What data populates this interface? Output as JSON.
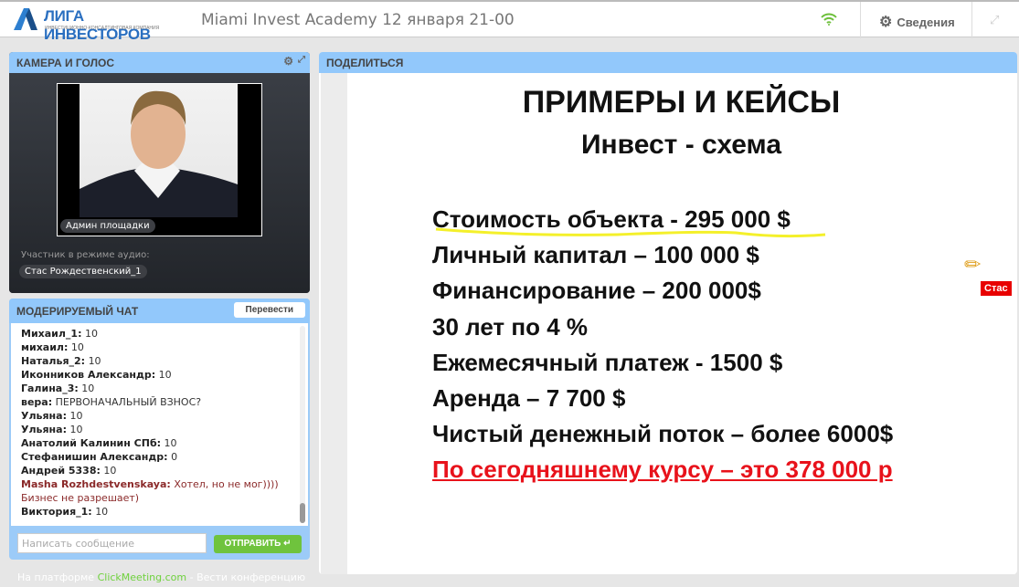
{
  "header": {
    "logo_name": "ЛИГА ИНВЕСТОРОВ",
    "logo_tagline": "ИНВЕСТИЦИОННО-КОНСАЛТИНГОВАЯ КОМПАНИЯ",
    "title": "Miami Invest Academy 12 января 21-00",
    "info_label": "Сведения"
  },
  "camera": {
    "title": "КАМЕРА И ГОЛОС",
    "presenter": "Админ площадки",
    "audio_label": "Участник в режиме аудио:",
    "audio_participant": "Стас Рождественский_1"
  },
  "chat": {
    "title": "МОДЕРИРУЕМЫЙ ЧАТ",
    "translate_label": "Перевести",
    "messages": [
      {
        "name": "Михаил_1:",
        "text": "10"
      },
      {
        "name": "михаил:",
        "text": "10"
      },
      {
        "name": "Наталья_2:",
        "text": "10"
      },
      {
        "name": "Иконников Александр:",
        "text": "10"
      },
      {
        "name": "Галина_3:",
        "text": "10"
      },
      {
        "name": "вера:",
        "text": "ПЕРВОНАЧАЛЬНЫЙ ВЗНОС?"
      },
      {
        "name": "Ульяна:",
        "text": "10"
      },
      {
        "name": "Ульяна:",
        "text": "10"
      },
      {
        "name": "Анатолий Калинин СПб:",
        "text": "10"
      },
      {
        "name": "Стефанишин Александр:",
        "text": "0"
      },
      {
        "name": "Андрей 5338:",
        "text": "10"
      },
      {
        "name": "Masha Rozhdestvenskaya:",
        "text": "Хотел, но не мог))))",
        "text2": "Бизнес не разрешает)"
      },
      {
        "name": "Виктория_1:",
        "text": "10"
      }
    ],
    "input_placeholder": "Написать сообщение",
    "send_label": "ОТПРАВИТЬ"
  },
  "share": {
    "title": "ПОДЕЛИТЬСЯ",
    "slide_title": "ПРИМЕРЫ И КЕЙСЫ",
    "slide_subtitle": "Инвест - схема",
    "lines": [
      "Стоимость объекта  - 295 000 $",
      "Личный капитал – 100 000 $",
      "Финансирование – 200 000$",
      "30 лет по 4 %",
      "Ежемесячный платеж -  1500 $",
      "Аренда – 7 700 $",
      "Чистый денежный поток – более 6000$",
      "По сегодняшнему курсу – это 378 000 р"
    ],
    "annotator": "Стас"
  },
  "footer": {
    "prefix": "На платформе",
    "brand": "ClickMeeting.com",
    "suffix": "- Вести конференцию"
  }
}
